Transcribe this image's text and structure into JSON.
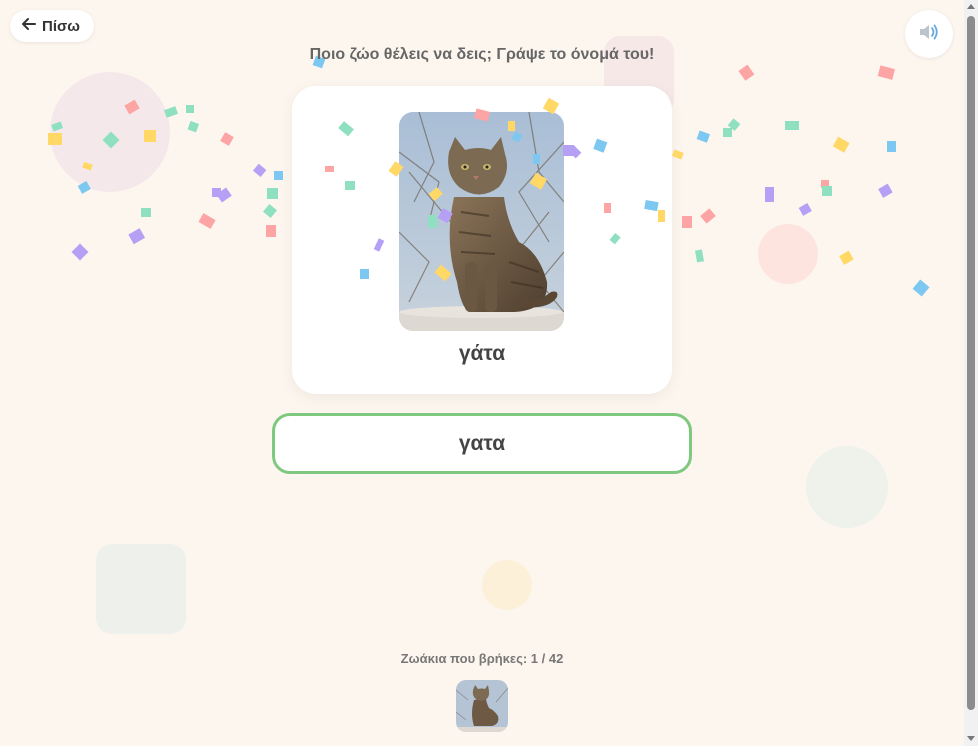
{
  "header": {
    "back_label": "Πίσω",
    "back_icon": "arrow-left-icon",
    "sound_icon": "speaker-icon"
  },
  "prompt": "Ποιο ζώο θέλεις να δεις; Γράψε το όνομά του!",
  "card": {
    "image": "cat-photo",
    "word": "γάτα"
  },
  "answer": {
    "value": "γατα",
    "border_color": "#7fc97f"
  },
  "progress": {
    "label": "Ζωάκια που βρήκες: 1 / 42",
    "found": 1,
    "total": 42
  },
  "found_animals": [
    "cat-thumbnail"
  ],
  "colors": {
    "background": "#fdf6ef",
    "confetti": [
      "#fda4a4",
      "#8ee0c0",
      "#ffd866",
      "#b6a0f5",
      "#7cc8f0"
    ]
  }
}
